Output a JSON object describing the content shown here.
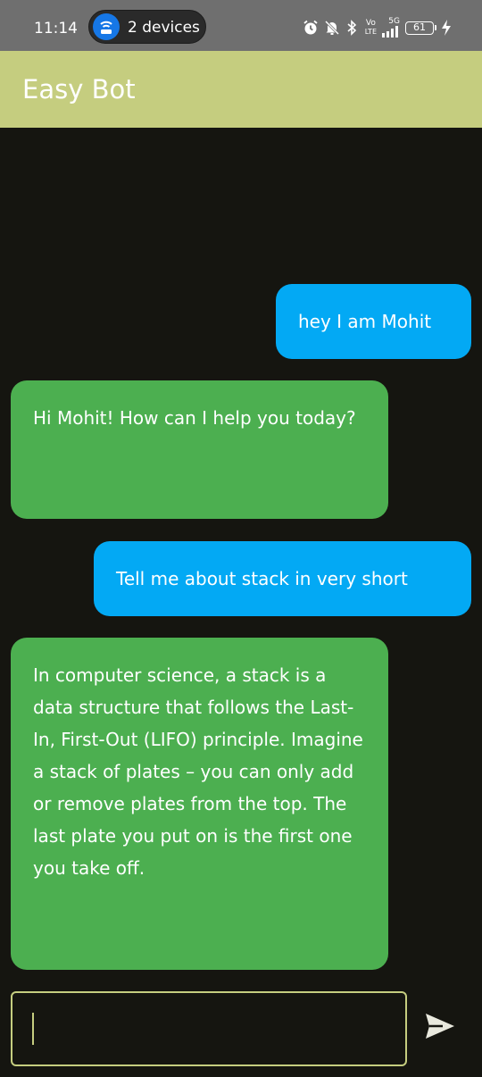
{
  "status_bar": {
    "time": "11:14",
    "hotspot_label": "2 devices",
    "battery_level": "61",
    "network_vo": "Vo",
    "network_lte": "LTE",
    "network_type": "5G",
    "icons": [
      "alarm-icon",
      "bell-off-icon",
      "bluetooth-icon",
      "volte-icon",
      "signal-5g-icon",
      "battery-icon",
      "charging-icon"
    ]
  },
  "app_bar": {
    "title": "Easy Bot",
    "background": "#c5cd7f"
  },
  "chat": {
    "messages": [
      {
        "sender": "user",
        "text": "hey I am Mohit"
      },
      {
        "sender": "bot",
        "text": "Hi Mohit! How can I help you today?"
      },
      {
        "sender": "user",
        "text": "Tell me about stack in very short"
      },
      {
        "sender": "bot",
        "text": "In computer science, a stack is a data structure that follows the Last-In, First-Out (LIFO) principle.  Imagine a stack of plates – you can only add or remove plates from the top.  The last plate you put on is the first one you take off."
      }
    ],
    "user_bubble_color": "#03a9f4",
    "bot_bubble_color": "#4caf50"
  },
  "composer": {
    "value": "",
    "placeholder": "",
    "send_icon": "send-icon"
  },
  "colors": {
    "background": "#151510",
    "accent": "#c5cd7f"
  }
}
